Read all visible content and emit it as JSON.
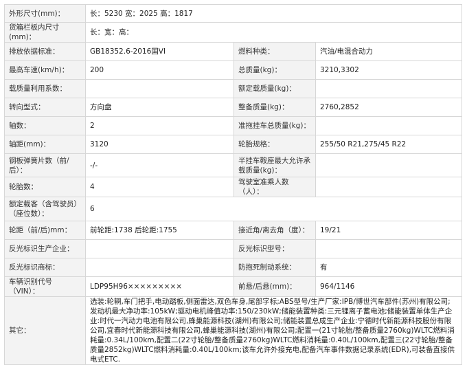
{
  "rows": [
    {
      "label": "外形尺寸(mm)：",
      "value": "长：5230 宽：2025 高：1817"
    },
    {
      "label": "货箱栏板内尺寸(mm)：",
      "value": "长：宽：高："
    },
    {
      "label": "排放依据标准：",
      "value": "GB18352.6-2016国VI",
      "label2": "燃料种类：",
      "value2": "汽油/电混合动力"
    },
    {
      "label": "最高车速(km/h)：",
      "value": "200",
      "label2": "总质量(kg)：",
      "value2": "3210,3302"
    },
    {
      "label": "载质量利用系数：",
      "value": "",
      "label2": "额定载质量(kg)：",
      "value2": ""
    },
    {
      "label": "转向型式：",
      "value": "方向盘",
      "label2": "整备质量(kg)：",
      "value2": "2760,2852"
    },
    {
      "label": "轴数：",
      "value": "2",
      "label2": "准拖挂车总质量(kg)：",
      "value2": ""
    },
    {
      "label": "轴距(mm)：",
      "value": "3120",
      "label2": "轮胎规格：",
      "value2": "255/50 R21,275/45 R22"
    },
    {
      "label": "钢板弹簧片数（前/后）：",
      "value": "-/-",
      "label2": "半挂车鞍座最大允许承载质量(kg)：",
      "value2": ""
    },
    {
      "label": "轮胎数：",
      "value": "4",
      "label2": "驾驶室准乘人数（人）：",
      "value2": ""
    },
    {
      "label": "额定载客（含驾驶员）（座位数）：",
      "value": "6"
    },
    {
      "label": "轮距（前/后)mm：",
      "value": "前轮距:1738 后轮距:1755",
      "label2": "接近角/离去角（度）：",
      "value2": "19/21"
    },
    {
      "label": "反光标识生产企业：",
      "value": "",
      "label2": "反光标识型号：",
      "value2": ""
    },
    {
      "label": "反光标识商标：",
      "value": "",
      "label2": "防抱死制动系统：",
      "value2": "有"
    },
    {
      "label": "车辆识别代号（VIN）：",
      "value": "LDP95H96×××××××××",
      "label2": "前悬/后悬(mm)：",
      "value2": "964/1146"
    }
  ],
  "other": {
    "label": "其它：",
    "value": "选装:轮辋,车门把手,电动踏板,侧面雷达,双色车身,尾部字标;ABS型号/生产厂家:IPB/博世汽车部件(苏州)有限公司;发动机最大净功率:105kW;驱动电机峰值功率:150/230kW;储能装置种类:三元锂离子蓄电池;储能装置单体生产企业:时代一汽动力电池有限公司,蜂巢能源科技(湖州)有限公司;储能装置总成生产企业:宁德时代新能源科技股份有限公司,宜春时代新能源科技有限公司,蜂巢能源科技(湖州)有限公司;配置一(21寸轮胎/整备质量2760kg)WLTC燃料消耗量:0.34L/100km,配置二(22寸轮胎/整备质量2760kg)WLTC燃料消耗量:0.40L/100km,配置三(22寸轮胎/整备质量2852kg)WLTC燃料消耗量:0.40L/100km;该车允许外接充电,配备汽车事件数据记录系统(EDR),可装备直接供电式ETC."
  }
}
